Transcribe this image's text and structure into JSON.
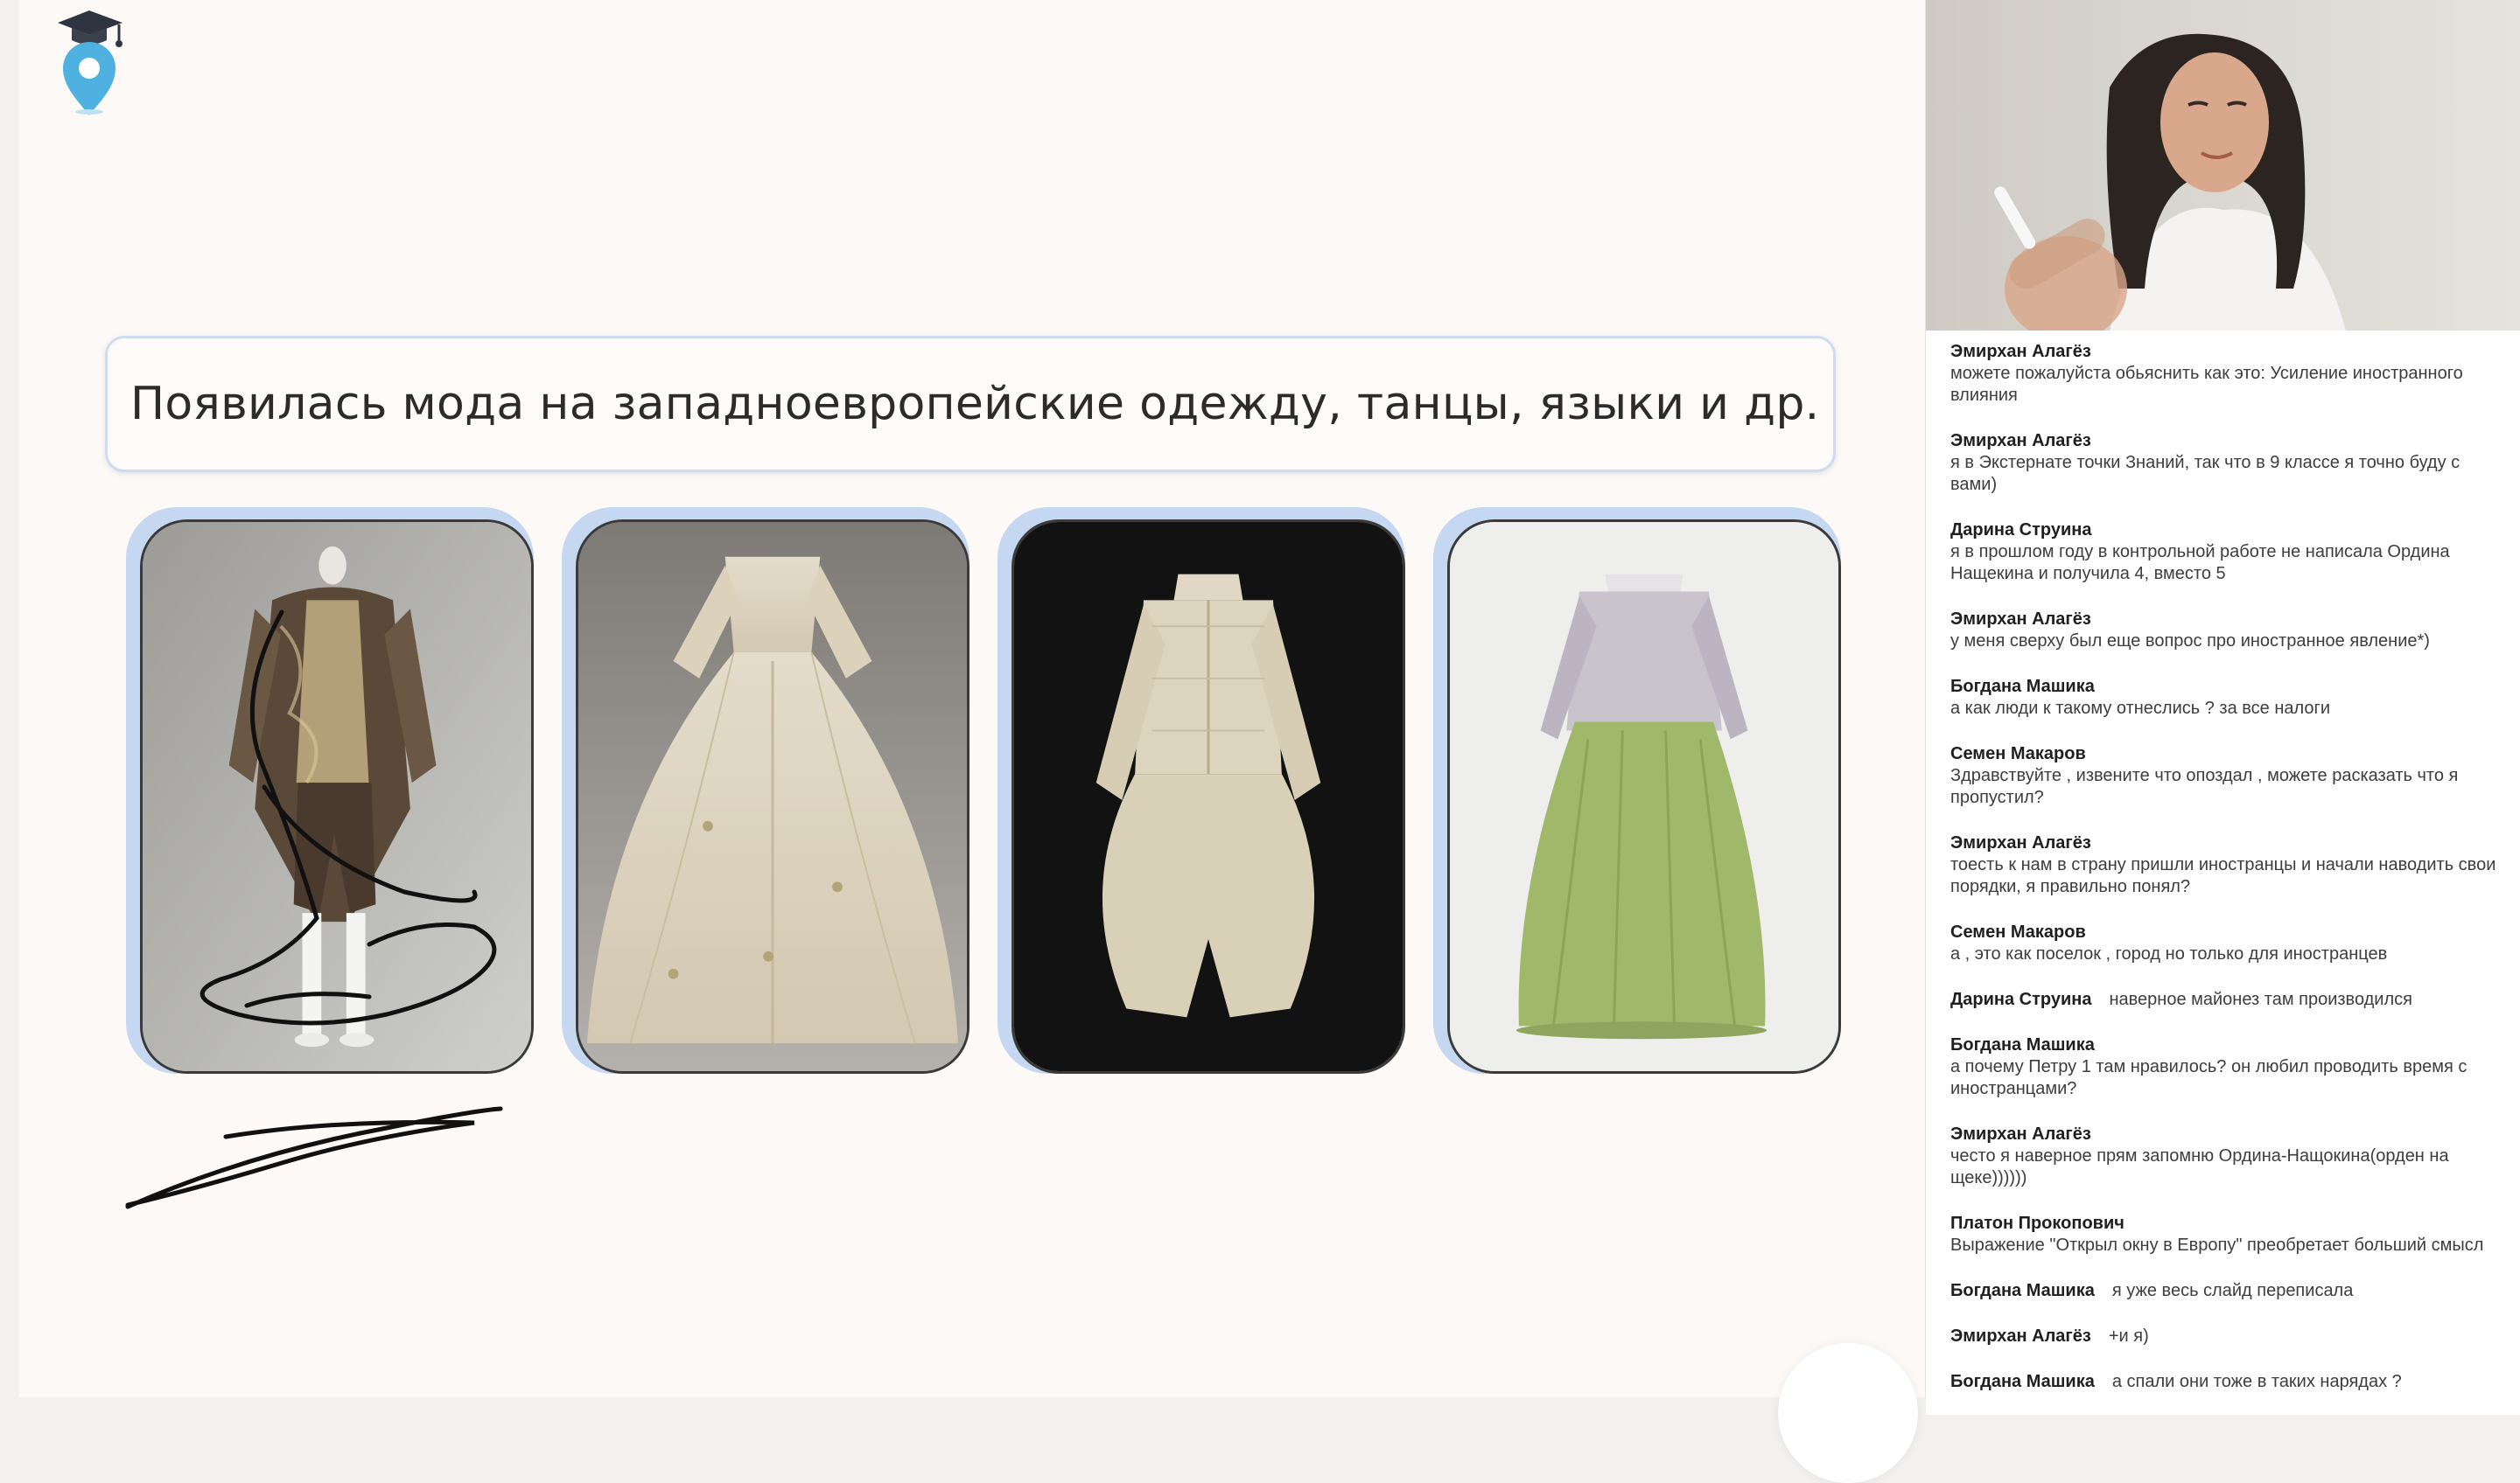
{
  "slide": {
    "headline": "Появилась мода на западноевропейские одежду, танцы, языки и др.",
    "images": [
      {
        "subject": "male-costume-brown"
      },
      {
        "subject": "ivory-gown"
      },
      {
        "subject": "embroidered-doublet"
      },
      {
        "subject": "green-skirt-jacket"
      }
    ]
  },
  "chat": {
    "messages": [
      {
        "author": "Эмирхан Алагёз",
        "text": "можете пожалуйста обьяснить как это: Усиление иностранного влияния",
        "layout": "stack"
      },
      {
        "author": "Эмирхан Алагёз",
        "text": "я  в Экстернате точки Знаний, так что в 9 классе я точно буду с вами)",
        "layout": "stack"
      },
      {
        "author": "Дарина Струина",
        "text": "я в прошлом году в контрольной работе не написала Ордина Нащекина и получила 4, вместо 5",
        "layout": "stack"
      },
      {
        "author": "Эмирхан Алагёз",
        "text": "у меня сверху был еще вопрос про иностранное явление*)",
        "layout": "stack"
      },
      {
        "author": "Богдана Машика",
        "text": "а как люди к такому отнеслись ? за все налоги",
        "layout": "stack"
      },
      {
        "author": "Семен Макаров",
        "text": "Здравствуйте , извените что опоздал , можете расказать что я пропустил?",
        "layout": "stack"
      },
      {
        "author": "Эмирхан Алагёз",
        "text": "тоесть к нам в страну пришли иностранцы и начали наводить свои порядки, я правильно понял?",
        "layout": "stack"
      },
      {
        "author": "Семен Макаров",
        "text": "а , это как поселок , город но только для иностранцев",
        "layout": "stack"
      },
      {
        "author": "Дарина Струина",
        "text": "наверное майонез там производился",
        "layout": "inline"
      },
      {
        "author": "Богдана Машика",
        "text": "а почему Петру 1 там нравилось? он любил проводить время с иностранцами?",
        "layout": "stack"
      },
      {
        "author": "Эмирхан Алагёз",
        "text": "често я наверное прям запомню Ордина-Нащокина(орден на щеке))))))",
        "layout": "stack"
      },
      {
        "author": "Платон Прокопович",
        "text": "Выражение \"Открыл окну в Европу\" преобретает больший смысл",
        "layout": "stack"
      },
      {
        "author": "Богдана Машика",
        "text": "я уже весь слайд переписала",
        "layout": "inline"
      },
      {
        "author": "Эмирхан Алагёз",
        "text": "+и я)",
        "layout": "inline"
      },
      {
        "author": "Богдана Машика",
        "text": "а спали они тоже в таких нарядах ?",
        "layout": "inline"
      }
    ]
  },
  "colors": {
    "slide_bg": "#fcf9f6",
    "frame_accent": "#c5d7f1",
    "logo_blue": "#4fb1e0",
    "logo_cap": "#2f3540"
  }
}
